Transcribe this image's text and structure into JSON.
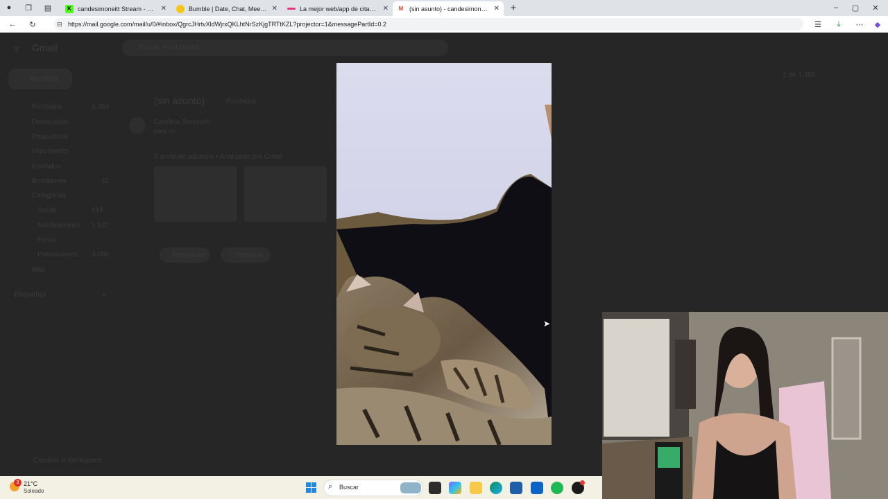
{
  "browser": {
    "tabs": [
      {
        "title": "candesimoneitt Stream - Watch L",
        "favicon": "K",
        "color": "#53fc18",
        "active": false
      },
      {
        "title": "Bumble | Date, Chat, Meet New P",
        "favicon": "",
        "color": "#f5c518",
        "active": false
      },
      {
        "title": "La mejor web/app de citas gratis",
        "favicon": "",
        "color": "#e6337a",
        "active": false
      },
      {
        "title": "(sin asunto) - candesimoneit@gm",
        "favicon": "M",
        "color": "#ea4335",
        "active": true
      }
    ],
    "url": "https://mail.google.com/mail/u/0/#inbox/QgrcJHrtvXldWjrxQKLhtNrSzKjgTRTtKZL?projector=1&messagePartId=0.2"
  },
  "gmail": {
    "logo": "Gmail",
    "search_placeholder": "Buscar en el correo",
    "compose": "Redactar",
    "nav": [
      {
        "label": "Recibidos",
        "count": "4.454"
      },
      {
        "label": "Destacados",
        "count": ""
      },
      {
        "label": "Pospuestos",
        "count": ""
      },
      {
        "label": "Importantes",
        "count": ""
      },
      {
        "label": "Enviados",
        "count": ""
      },
      {
        "label": "Borradores",
        "count": "11"
      },
      {
        "label": "Categorías",
        "count": ""
      },
      {
        "label": "Social",
        "count": "919"
      },
      {
        "label": "Notificaciones",
        "count": "1.137"
      },
      {
        "label": "Foros",
        "count": ""
      },
      {
        "label": "Promociones",
        "count": "3.000"
      },
      {
        "label": "Más",
        "count": ""
      }
    ],
    "labels_header": "Etiquetas",
    "subject": "(sin asunto)",
    "inbox_chip": "Recibidos",
    "sender": "Candela Simoneit",
    "to": "para mí",
    "attachments_label": "2 archivos adjuntos • Analizado por Gmail",
    "reply": "Responder",
    "forward": "Reenviar",
    "upgrade": "Cambiar a Workspace",
    "pagination": "1 de 4.456"
  },
  "taskbar": {
    "weather_temp": "21°C",
    "weather_desc": "Soleado",
    "weather_badge": "3",
    "search_label": "Buscar"
  }
}
